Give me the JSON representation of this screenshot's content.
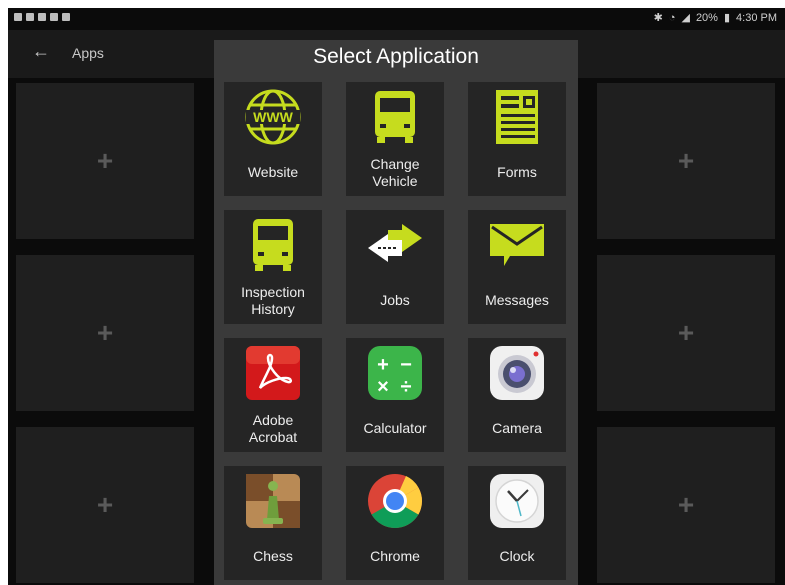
{
  "status_bar": {
    "battery": "20%",
    "time": "4:30 PM"
  },
  "app_bar": {
    "title": "Apps"
  },
  "placeholder_symbol": "+",
  "dialog": {
    "title": "Select Application",
    "apps": [
      {
        "name": "Website",
        "icon": "globe-www-icon"
      },
      {
        "name": "Change\nVehicle",
        "icon": "truck-icon"
      },
      {
        "name": "Forms",
        "icon": "form-document-icon"
      },
      {
        "name": "Inspection\nHistory",
        "icon": "truck-history-icon"
      },
      {
        "name": "Jobs",
        "icon": "arrows-swap-icon"
      },
      {
        "name": "Messages",
        "icon": "envelope-icon"
      },
      {
        "name": "Adobe\nAcrobat",
        "icon": "acrobat-icon"
      },
      {
        "name": "Calculator",
        "icon": "calculator-icon"
      },
      {
        "name": "Camera",
        "icon": "camera-icon"
      },
      {
        "name": "Chess",
        "icon": "chess-icon"
      },
      {
        "name": "Chrome",
        "icon": "chrome-icon"
      },
      {
        "name": "Clock",
        "icon": "clock-icon"
      }
    ]
  },
  "colors": {
    "accent": "#c6dc1e",
    "dialog_bg": "#3a3a3a",
    "tile_bg": "#252525"
  }
}
